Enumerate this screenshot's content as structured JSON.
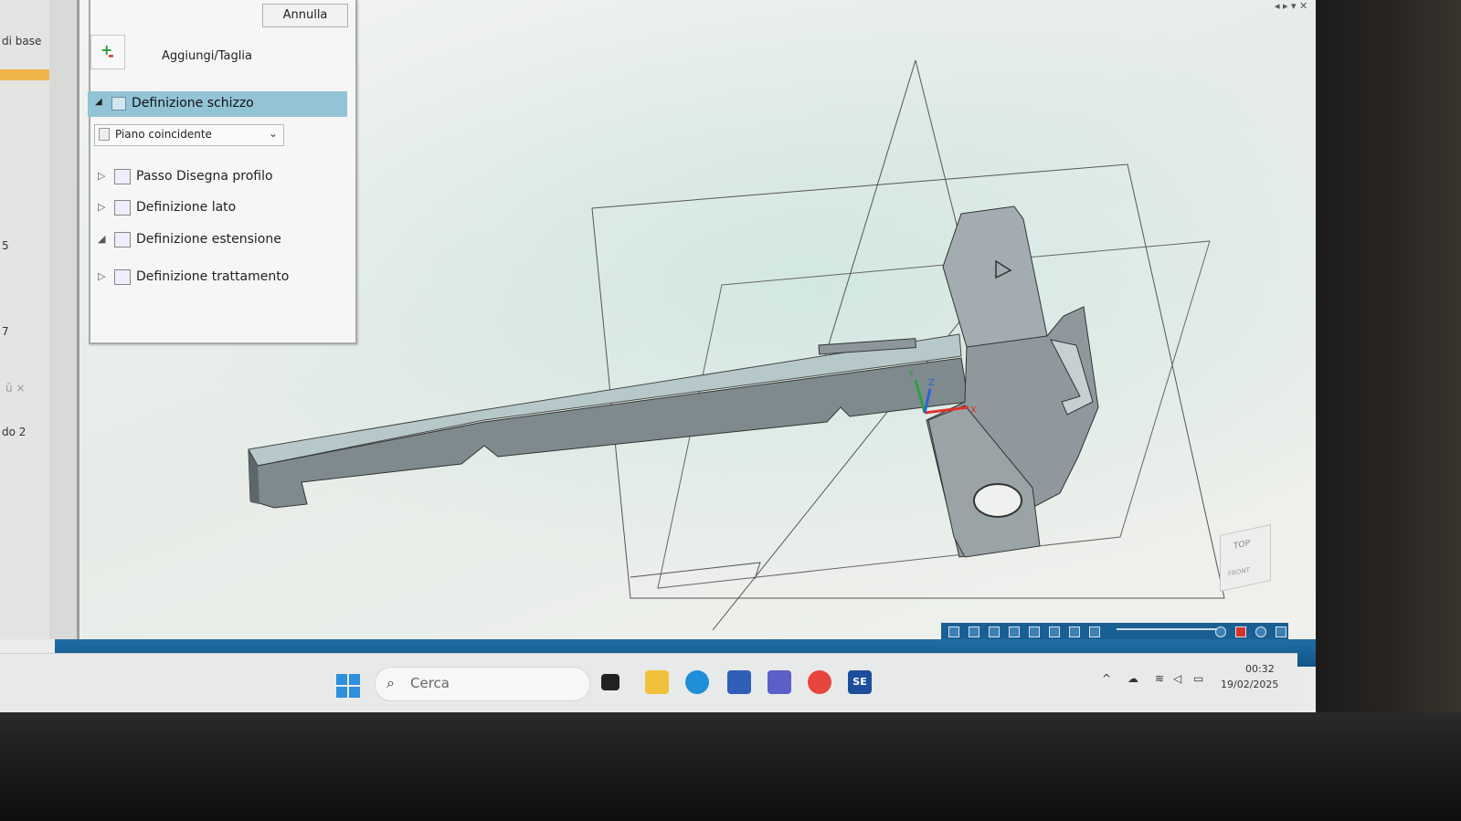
{
  "left_strip": {
    "label_base": "di base",
    "label_five": "5",
    "label_seven": "7",
    "label_do2": "do 2",
    "mini_ctrls": "ū ×"
  },
  "panel": {
    "cancel_label": "Annulla",
    "add_cut_label": "Aggiungi/Taglia",
    "steps": [
      {
        "label": "Definizione schizzo",
        "expanded": true,
        "selected": true
      },
      {
        "label": "Passo Disegna profilo",
        "expanded": false
      },
      {
        "label": "Definizione lato",
        "expanded": false
      },
      {
        "label": "Definizione estensione",
        "expanded": true
      },
      {
        "label": "Definizione trattamento",
        "expanded": false
      }
    ],
    "plane_select": {
      "value": "Piano coincidente"
    }
  },
  "axes": {
    "x": "X",
    "y": "Y",
    "z": "Z"
  },
  "view_cube": {
    "top": "TOP",
    "front": "FRONT"
  },
  "taskbar": {
    "search_placeholder": "Cerca",
    "se_app": "SE",
    "clock_time": "00:32",
    "clock_date": "19/02/2025"
  },
  "colors": {
    "selection": "#93c3d6",
    "status_bar": "#1f6fa6",
    "model_gray": "#9aa3a6",
    "x_axis": "#e0312a",
    "y_axis": "#2aa13c",
    "z_axis": "#2a64d6"
  }
}
